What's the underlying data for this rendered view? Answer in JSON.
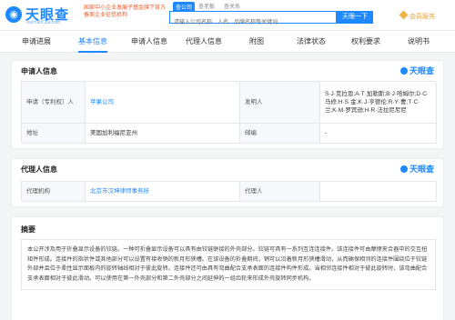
{
  "header": {
    "logo_text": "天眼查",
    "logo_sub": "TianYanCha.com",
    "promo": "国家中小企业发展子基金旗下官方备案企业征信机构",
    "search_tabs": [
      "查公司",
      "查老板",
      "查关系"
    ],
    "search_placeholder": "请输入公司名称、人名、品牌名称等关键词",
    "search_button": "天眼一下",
    "member_label": "会员服务"
  },
  "nav": {
    "tabs": [
      "申请进展",
      "基本信息",
      "申请人信息",
      "代理人信息",
      "附图",
      "法律状态",
      "权利要求",
      "说明书"
    ],
    "active_index": 1
  },
  "applicant": {
    "title": "申请人信息",
    "brand": "天眼查",
    "rows": [
      {
        "label": "申请（专利权）人",
        "value": "苹果公司",
        "label2": "发明人",
        "value2": "S·J·克拉恩;A·T·加勒斯;B·J·哈姆尔;D·C·马修;H·S·金;K·J·亨德伦;R·Y·曹;T·C·兰;K·M·罗宾逊;H·R·法拉尼尼尼"
      },
      {
        "label": "地址",
        "value": "美国加利福尼亚州",
        "label2": "邮编",
        "value2": "-"
      }
    ]
  },
  "agent": {
    "title": "代理人信息",
    "brand": "天眼查",
    "rows": [
      {
        "label": "代理机构",
        "value": "北京市汉坤律师事务所",
        "label2": "代理人",
        "value2": ""
      }
    ]
  },
  "abstract": {
    "title": "摘要",
    "text": "本公开涉及用于折叠显示设备的铰链。一种可折叠显示设备可以具有由铰链联接的外壳部分。铰链可具有一系列互连连接件。该连接件可由摩擦夹合器中的交互扭矩件形成。连接件的指状件或其他部分可以设置有接收销的新月形狭槽。在该设备的折叠期间，销可以沿着新月形狭槽滑动，从而确保相邻的连接件围绕位于铰链外部并且位于柔性显示面板内的旋转轴线相对于彼此旋转。连接件还可由具有弯曲配合支承表面的连接件构件形成。当相邻连接件相对于彼此旋转时，该弯曲配合支承表面相对于彼此滑动。可以使用在第一外壳部分和第二外壳部分之间延伸的一组齿轮来形成外壳旋转同步机构。"
  },
  "colors": {
    "accent": "#1e88ff",
    "promo": "#f05a28",
    "member": "#e8a03a"
  }
}
